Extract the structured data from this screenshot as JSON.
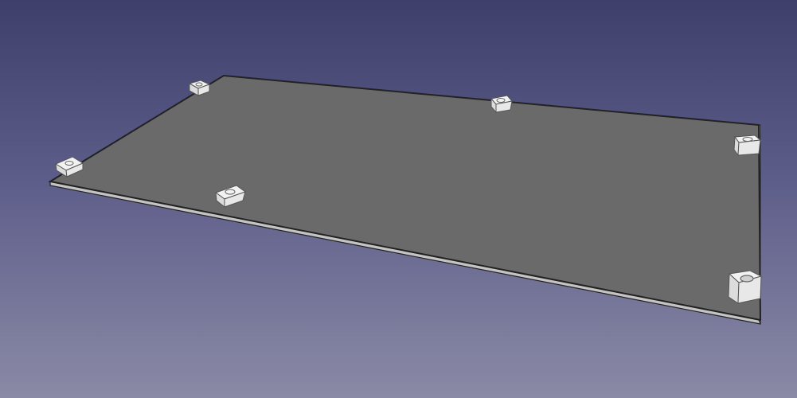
{
  "app": {
    "view": "3d-viewport"
  },
  "colors": {
    "background_top": "#3f3f6b",
    "background_bottom": "#8a8aa6",
    "plate_top": "#6a6a6a",
    "plate_edge": "#c4c4c4",
    "plate_outline": "#222222",
    "standoff_fill": "#f2f2f2",
    "standoff_side": "#d8d8d8",
    "standoff_outline": "#555555"
  },
  "scene": {
    "objects": [
      {
        "name": "base-plate",
        "type": "plate"
      },
      {
        "name": "standoff",
        "count": 6
      }
    ]
  }
}
